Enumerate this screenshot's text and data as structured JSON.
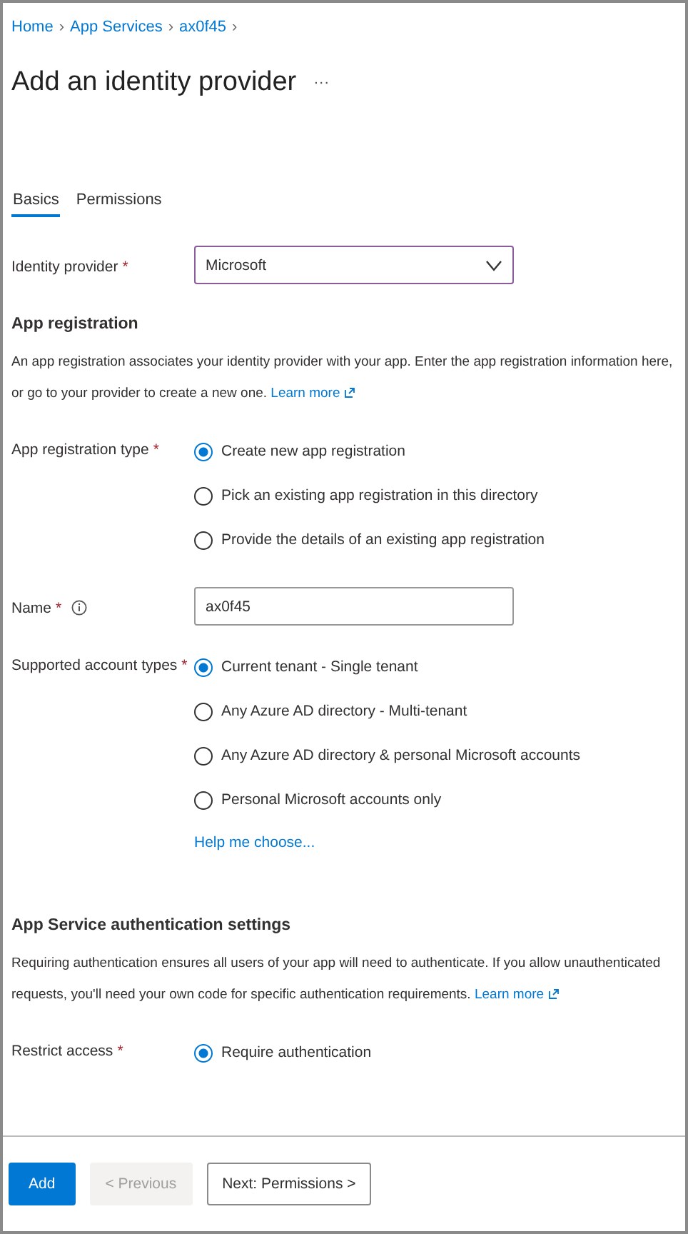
{
  "breadcrumb": [
    {
      "label": "Home"
    },
    {
      "label": "App Services"
    },
    {
      "label": "ax0f45"
    }
  ],
  "breadcrumb_separator": "›",
  "title": "Add an identity provider",
  "more": "···",
  "tabs": [
    {
      "label": "Basics",
      "selected": true
    },
    {
      "label": "Permissions",
      "selected": false
    }
  ],
  "identity_provider": {
    "label": "Identity provider",
    "required_mark": "*",
    "value": "Microsoft"
  },
  "app_registration": {
    "heading": "App registration",
    "description": "An app registration associates your identity provider with your app. Enter the app registration information here, or go to your provider to create a new one.",
    "link": "Learn more",
    "type_field": {
      "label": "App registration type",
      "required_mark": "*",
      "options": [
        {
          "label": "Create new app registration",
          "selected": true
        },
        {
          "label": "Pick an existing app registration in this directory",
          "selected": false
        },
        {
          "label": "Provide the details of an existing app registration",
          "selected": false
        }
      ]
    },
    "name_field": {
      "label": "Name",
      "required_mark": "*",
      "value": "ax0f45"
    },
    "account_types": {
      "label": "Supported account types",
      "required_mark": "*",
      "options": [
        {
          "label": "Current tenant - Single tenant",
          "selected": true
        },
        {
          "label": "Any Azure AD directory - Multi-tenant",
          "selected": false
        },
        {
          "label": "Any Azure AD directory & personal Microsoft accounts",
          "selected": false
        },
        {
          "label": "Personal Microsoft accounts only",
          "selected": false
        }
      ],
      "help_link": "Help me choose..."
    }
  },
  "auth_settings": {
    "heading": "App Service authentication settings",
    "description": "Requiring authentication ensures all users of your app will need to authenticate. If you allow unauthenticated requests, you'll need your own code for specific authentication requirements.",
    "link": "Learn more",
    "restrict_access": {
      "label": "Restrict access",
      "required_mark": "*",
      "options": [
        {
          "label": "Require authentication",
          "selected": true
        }
      ]
    }
  },
  "footer": [
    {
      "label": "Add",
      "kind": "primary",
      "disabled": false
    },
    {
      "label": "< Previous",
      "kind": "secondary",
      "disabled": true
    },
    {
      "label": "Next: Permissions >",
      "kind": "secondary",
      "disabled": false
    }
  ]
}
